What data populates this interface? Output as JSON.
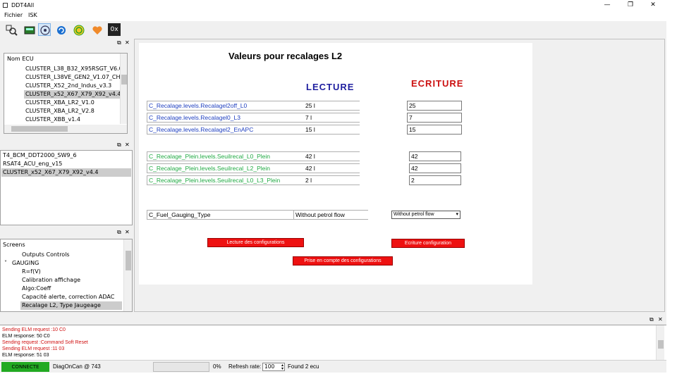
{
  "window": {
    "title": "DDT4All",
    "minimize": "—",
    "restore": "❐",
    "close": "✕"
  },
  "menu": {
    "items": [
      "Fichier",
      "ISK"
    ]
  },
  "toolbar": {
    "icons": [
      "scan-ecu-icon",
      "ecu-icon",
      "network-icon",
      "refresh-icon",
      "power-icon",
      "heart-icon",
      "hex-icon"
    ],
    "hex_label": "0x"
  },
  "ecu_panel": {
    "header": "Nom ECU",
    "items": [
      "CLUSTER_L38_B32_X95RSGT_V6.0",
      "CLUSTER_L38VE_GEN2_V1.07_CHN",
      "CLUSTER_X52_2nd_Indus_v3.3",
      "CLUSTER_x52_X67_X79_X92_v4.4",
      "CLUSTER_XBA_LR2_V1.0",
      "CLUSTER_XBA_LR2_V2.8",
      "CLUSTER_XBB_v1.4"
    ],
    "selected_index": 3
  },
  "found_panel": {
    "items": [
      "T4_BCM_DDT2000_SW9_6",
      "RSAT4_ACU_eng_v15",
      "CLUSTER_x52_X67_X79_X92_v4.4"
    ],
    "selected_index": 2
  },
  "screens_panel": {
    "items": [
      {
        "label": "Screens",
        "indent": 0
      },
      {
        "label": "Outputs Controls",
        "indent": 2
      },
      {
        "label": "GAUGING",
        "indent": 1,
        "expander": "˅"
      },
      {
        "label": "R=f(V)",
        "indent": 2
      },
      {
        "label": "Calibration affichage",
        "indent": 2
      },
      {
        "label": "Algo:Coeff",
        "indent": 2
      },
      {
        "label": "Capacité alerte, correction ADAC",
        "indent": 2
      },
      {
        "label": "Recalage L2, Type Jaugeage",
        "indent": 2
      }
    ],
    "selected_index": 7
  },
  "screen": {
    "title": "Valeurs pour recalages L2",
    "lecture_header": "LECTURE",
    "ecriture_header": "ECRITURE",
    "params_group1": [
      {
        "name": "C_Recalage.levels.Recalagel2off_L0",
        "read": "25 l",
        "write": "25"
      },
      {
        "name": "C_Recalage.levels.Recalagel0_L3",
        "read": "7 l",
        "write": "7"
      },
      {
        "name": "C_Recalage.levels.Recalagel2_EnAPC",
        "read": "15 l",
        "write": "15"
      }
    ],
    "params_group2": [
      {
        "name": "C_Recalage_Plein.levels.Seuilrecal_L0_Plein",
        "read": "42 l",
        "write": "42"
      },
      {
        "name": "C_Recalage_Plein.levels.Seuilrecal_L2_Plein",
        "read": "42 l",
        "write": "42"
      },
      {
        "name": "C_Recalage_Plein.levels.Seuilrecal_L0_L3_Plein",
        "read": "2 l",
        "write": "2"
      }
    ],
    "fuel": {
      "name": "C_Fuel_Gauging_Type",
      "read": "Without petrol flow",
      "write": "Without petrol flow"
    },
    "buttons": {
      "read_config": "Lecture des configurations",
      "write_config": "Ecriture configuration",
      "apply_config": "Prise en compte des configurations"
    }
  },
  "log": {
    "lines": [
      {
        "text": "Sending ELM request :10 C0",
        "color": "red"
      },
      {
        "text": "ELM response: 50 C0",
        "color": "black"
      },
      {
        "text": "Sending request :Command Soft Reset",
        "color": "red"
      },
      {
        "text": "Sending ELM request :11 03",
        "color": "red"
      },
      {
        "text": "ELM response: 51 03",
        "color": "black"
      }
    ]
  },
  "status": {
    "connection": "CONNECTE",
    "connection_color": "#22aa22",
    "protocol": "DiagOnCan @ 743",
    "progress": "0%",
    "progress_value": 0,
    "refresh_label": "Refresh rate:",
    "refresh_value": "100",
    "found": "Found 2 ecu"
  }
}
